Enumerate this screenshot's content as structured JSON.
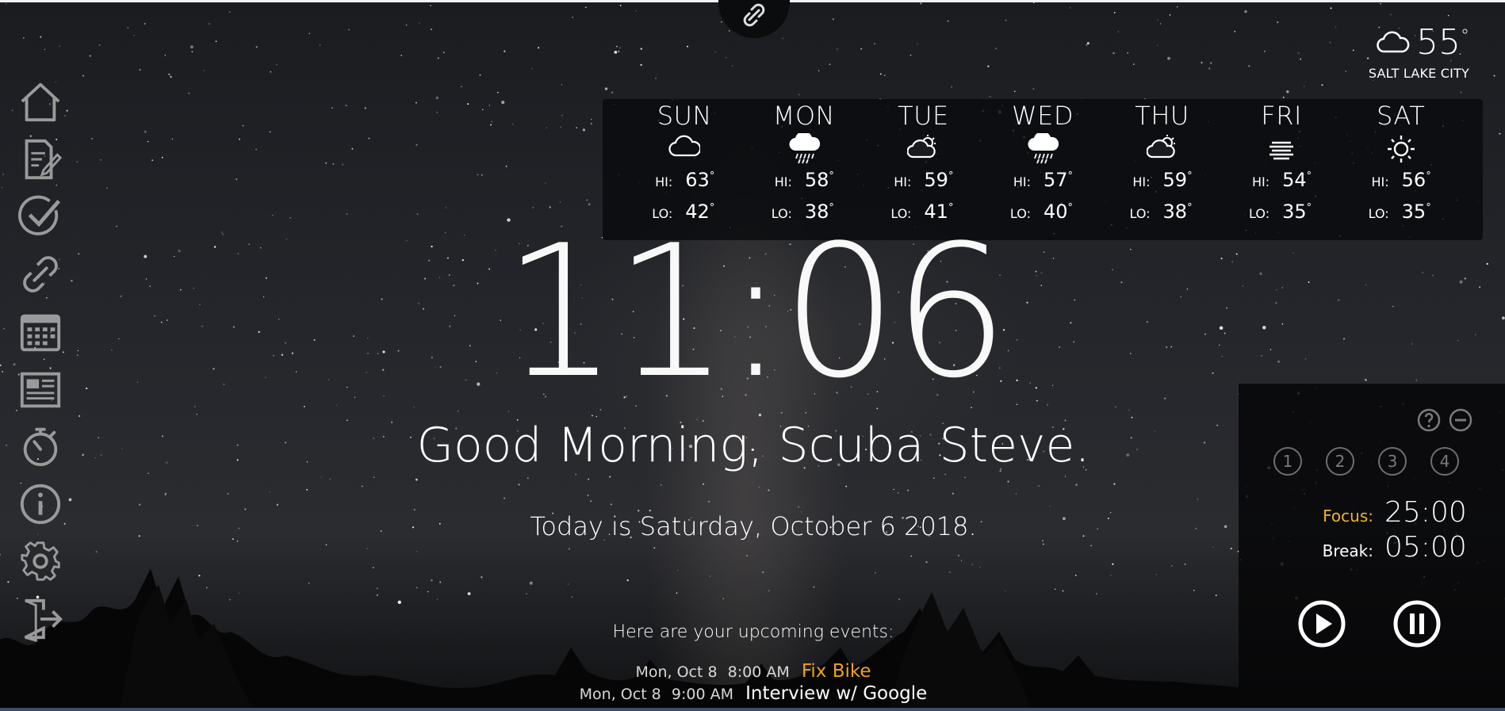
{
  "weather_now": {
    "icon": "cloud-icon",
    "temp": "55",
    "degree": "°",
    "city": "SALT LAKE CITY"
  },
  "forecast": [
    {
      "day": "SUN",
      "icon": "cloudy",
      "hi_label": "HI:",
      "hi": "63",
      "lo_label": "LO:",
      "lo": "42"
    },
    {
      "day": "MON",
      "icon": "rain",
      "hi_label": "HI:",
      "hi": "58",
      "lo_label": "LO:",
      "lo": "38"
    },
    {
      "day": "TUE",
      "icon": "partly-cloudy",
      "hi_label": "HI:",
      "hi": "59",
      "lo_label": "LO:",
      "lo": "41"
    },
    {
      "day": "WED",
      "icon": "rain",
      "hi_label": "HI:",
      "hi": "57",
      "lo_label": "LO:",
      "lo": "40"
    },
    {
      "day": "THU",
      "icon": "partly-cloudy",
      "hi_label": "HI:",
      "hi": "59",
      "lo_label": "LO:",
      "lo": "38"
    },
    {
      "day": "FRI",
      "icon": "fog",
      "hi_label": "HI:",
      "hi": "54",
      "lo_label": "LO:",
      "lo": "35"
    },
    {
      "day": "SAT",
      "icon": "sunny",
      "hi_label": "HI:",
      "hi": "56",
      "lo_label": "LO:",
      "lo": "35"
    }
  ],
  "clock": {
    "time": "11:06"
  },
  "greeting": "Good Morning, Scuba Steve.",
  "date_line": "Today is Saturday, October 6 2018.",
  "events": {
    "heading": "Here are your upcoming events:",
    "items": [
      {
        "date": "Mon, Oct 8",
        "time": "8:00 AM",
        "title": "Fix Bike",
        "color": "#f0a020"
      },
      {
        "date": "Mon, Oct 8",
        "time": "9:00 AM",
        "title": "Interview w/ Google",
        "color": "#ffffff"
      }
    ]
  },
  "pomodoro": {
    "sessions": [
      "1",
      "2",
      "3",
      "4"
    ],
    "focus_label": "Focus:",
    "focus_time": "25:00",
    "break_label": "Break:",
    "break_time": "05:00",
    "focus_color": "#f0b429"
  },
  "sidebar": {
    "items": [
      "home-icon",
      "notes-icon",
      "tasks-icon",
      "links-icon",
      "calendar-icon",
      "news-icon",
      "timer-icon",
      "info-icon",
      "settings-icon",
      "logout-icon"
    ]
  }
}
